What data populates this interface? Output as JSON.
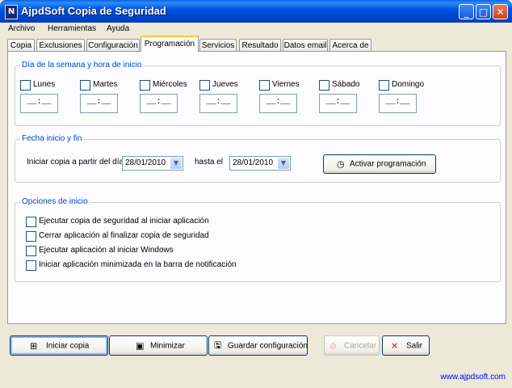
{
  "window": {
    "title": "AjpdSoft Copia de Seguridad",
    "icon_glyph": "N",
    "controls": {
      "minimize": "_",
      "maximize": "□",
      "close": "✕"
    }
  },
  "menu": [
    "Archivo",
    "Herramientas",
    "Ayuda"
  ],
  "tabs": [
    "Copia",
    "Exclusiones",
    "Configuración",
    "Programación",
    "Servicios",
    "Resultado",
    "Datos email",
    "Acerca de"
  ],
  "active_tab": "Programación",
  "schedule": {
    "legend": "Día de la semana y hora de inicio",
    "days": [
      {
        "label": "Lunes",
        "checked": false,
        "time": "__:__"
      },
      {
        "label": "Martes",
        "checked": false,
        "time": "__:__"
      },
      {
        "label": "Miércoles",
        "checked": false,
        "time": "__:__"
      },
      {
        "label": "Jueves",
        "checked": false,
        "time": "__:__"
      },
      {
        "label": "Viernes",
        "checked": false,
        "time": "__:__"
      },
      {
        "label": "Sábado",
        "checked": false,
        "time": "__:__"
      },
      {
        "label": "Domingo",
        "checked": false,
        "time": "__:__"
      }
    ]
  },
  "dates": {
    "legend": "Fecha inicio y fin",
    "start_label": "Iniciar copia a partir del día",
    "start_value": "28/01/2010",
    "end_label": "hasta el",
    "end_value": "28/01/2010",
    "activate_button": "Activar programación"
  },
  "options": {
    "legend": "Opciones de inicio",
    "items": [
      {
        "label": "Ejecutar copia de seguridad al iniciar aplicación",
        "checked": false
      },
      {
        "label": "Cerrar aplicación al finalizar copia de seguridad",
        "checked": false
      },
      {
        "label": "Ejecutar aplicación al iniciar Windows",
        "checked": false
      },
      {
        "label": "Iniciar aplicación minimizada en la barra de notificación",
        "checked": false
      }
    ]
  },
  "buttons": {
    "start": "Iniciar copia",
    "minimize": "Minimizar",
    "save": "Guardar configuración",
    "cancel": "Cancelar",
    "exit": "Salir"
  },
  "footer": {
    "link": "www.ajpdsoft.com"
  }
}
